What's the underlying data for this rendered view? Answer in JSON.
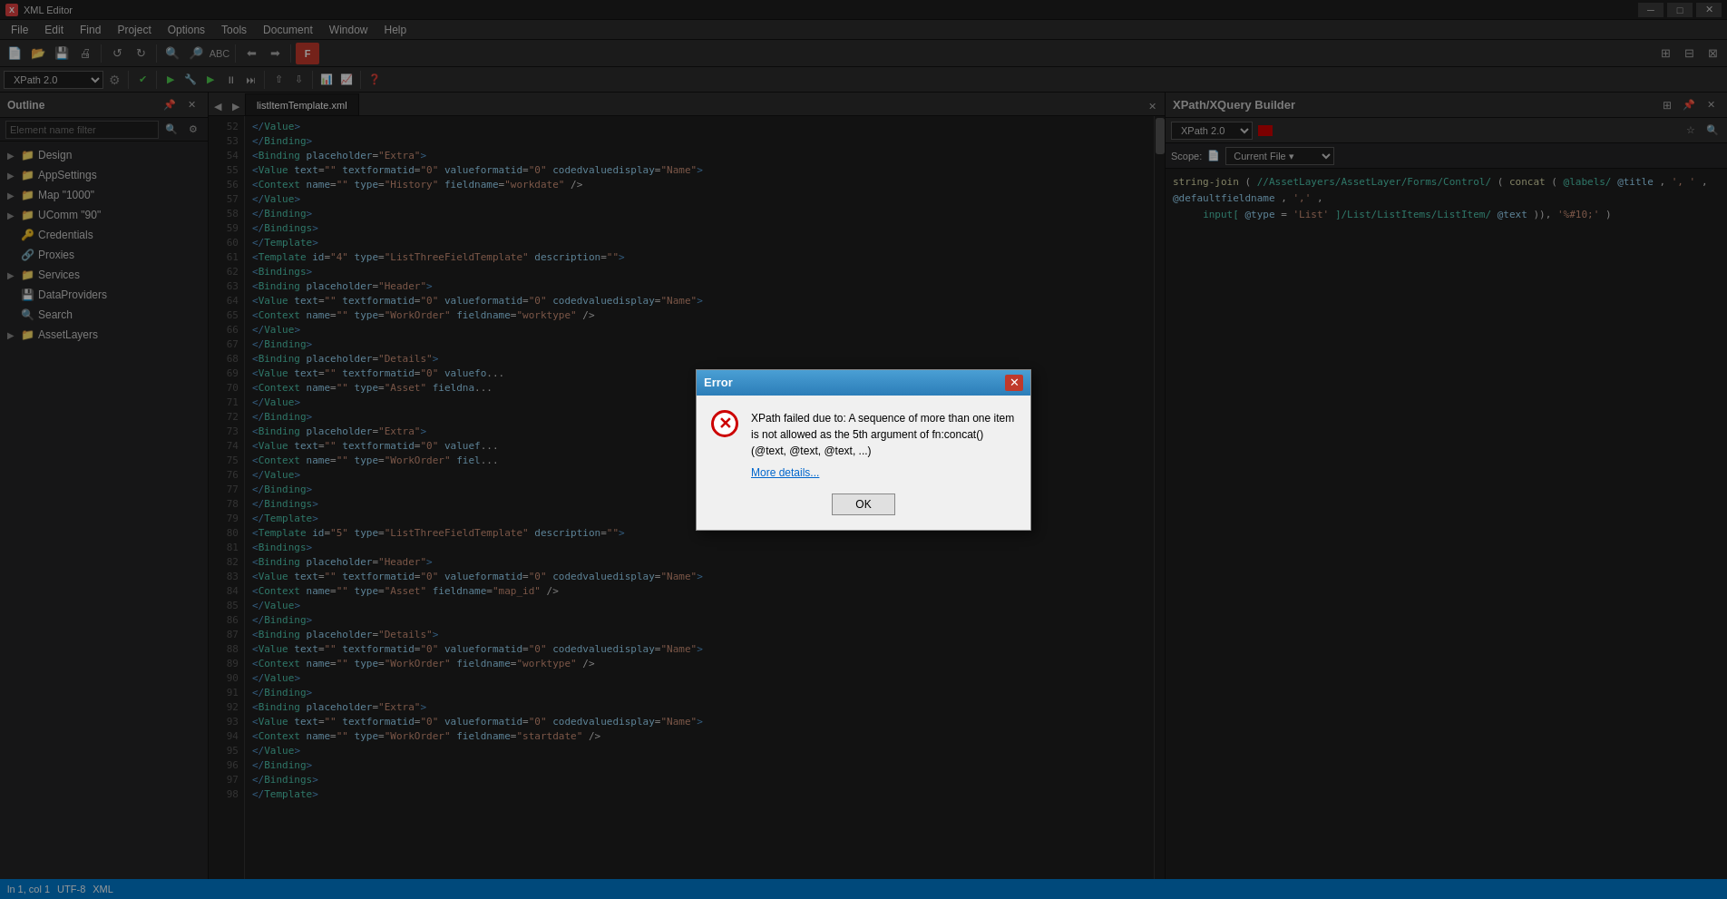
{
  "app": {
    "title": "XML Editor",
    "icon": "X"
  },
  "titlebar": {
    "minimize": "─",
    "maximize": "□",
    "close": "✕"
  },
  "menu": {
    "items": [
      "File",
      "Edit",
      "Find",
      "Project",
      "Options",
      "Tools",
      "Document",
      "Window",
      "Help"
    ]
  },
  "toolbar": {
    "buttons": [
      "📄",
      "📂",
      "💾",
      "🖨",
      "↺",
      "↻",
      "🔍",
      "🔎",
      "📋",
      "⬅",
      "➡",
      "🔴"
    ],
    "xpath_label": "XPath 2.0",
    "play_btn": "▶",
    "tools": [
      "⚙",
      "✔",
      "▶",
      "🔧",
      "▶",
      "⏸",
      "⏭",
      "⏯",
      "🔀",
      "⤶",
      "⤷",
      "📊",
      "📈",
      "❓"
    ]
  },
  "sidebar": {
    "title": "Outline",
    "search_placeholder": "Element name filter",
    "tree_items": [
      {
        "label": "Design",
        "level": 1,
        "has_children": true,
        "expanded": false
      },
      {
        "label": "AppSettings",
        "level": 1,
        "has_children": true,
        "expanded": false
      },
      {
        "label": "Map \"1000\"",
        "level": 1,
        "has_children": true,
        "expanded": false
      },
      {
        "label": "UComm \"90\"",
        "level": 1,
        "has_children": true,
        "expanded": false
      },
      {
        "label": "Credentials",
        "level": 1,
        "has_children": false,
        "expanded": false
      },
      {
        "label": "Proxies",
        "level": 1,
        "has_children": false,
        "expanded": false
      },
      {
        "label": "Services",
        "level": 1,
        "has_children": true,
        "expanded": false
      },
      {
        "label": "DataProviders",
        "level": 1,
        "has_children": false,
        "expanded": false
      },
      {
        "label": "Search",
        "level": 1,
        "has_children": false,
        "expanded": false
      },
      {
        "label": "AssetLayers",
        "level": 1,
        "has_children": true,
        "expanded": false
      }
    ]
  },
  "editor": {
    "title": "listItemTemplate.xml",
    "lines": [
      {
        "num": 52,
        "code": "    </Value>"
      },
      {
        "num": 53,
        "code": "  </Binding>"
      },
      {
        "num": 54,
        "code": "<Binding placeholder=\"Extra\">"
      },
      {
        "num": 55,
        "code": "  <Value text=\"\" textformatid=\"0\" valueformatid=\"0\" codedvaluedisplay=\"Name\">"
      },
      {
        "num": 56,
        "code": "    <Context name=\"\" type=\"History\" fieldname=\"workdate\" />"
      },
      {
        "num": 57,
        "code": "  </Value>"
      },
      {
        "num": 58,
        "code": "</Binding>"
      },
      {
        "num": 59,
        "code": "</Bindings>"
      },
      {
        "num": 60,
        "code": "</Template>"
      },
      {
        "num": 61,
        "code": "<Template id=\"4\" type=\"ListThreeFieldTemplate\" description=\"\">"
      },
      {
        "num": 62,
        "code": "  <Bindings>"
      },
      {
        "num": 63,
        "code": "    <Binding placeholder=\"Header\">"
      },
      {
        "num": 64,
        "code": "      <Value text=\"\" textformatid=\"0\" valueformatid=\"0\" codedvaluedisplay=\"Name\">"
      },
      {
        "num": 65,
        "code": "        <Context name=\"\" type=\"WorkOrder\" fieldname=\"worktype\" />"
      },
      {
        "num": 66,
        "code": "      </Value>"
      },
      {
        "num": 67,
        "code": "    </Binding>"
      },
      {
        "num": 68,
        "code": "    <Binding placeholder=\"Details\">"
      },
      {
        "num": 69,
        "code": "      <Value text=\"\" textformatid=\"0\" valuef..."
      },
      {
        "num": 70,
        "code": "        <Context name=\"\" type=\"Asset\" fieldna..."
      },
      {
        "num": 71,
        "code": "      </Value>"
      },
      {
        "num": 72,
        "code": "    </Binding>"
      },
      {
        "num": 73,
        "code": "    <Binding placeholder=\"Extra\">"
      },
      {
        "num": 74,
        "code": "      <Value text=\"\" textformatid=\"0\" valuef..."
      },
      {
        "num": 75,
        "code": "        <Context name=\"\" type=\"WorkOrder\" fiel..."
      },
      {
        "num": 76,
        "code": "      </Value>"
      },
      {
        "num": 77,
        "code": "    </Binding>"
      },
      {
        "num": 78,
        "code": "  </Bindings>"
      },
      {
        "num": 79,
        "code": "</Template>"
      },
      {
        "num": 80,
        "code": "<Template id=\"5\" type=\"ListThreeFieldTemplate\" description=\"\">"
      },
      {
        "num": 81,
        "code": "  <Bindings>"
      },
      {
        "num": 82,
        "code": "    <Binding placeholder=\"Header\">"
      },
      {
        "num": 83,
        "code": "      <Value text=\"\" textformatid=\"0\" valueformatid=\"0\" codedvaluedisplay=\"Name\">"
      },
      {
        "num": 84,
        "code": "        <Context name=\"\" type=\"Asset\" fieldname=\"map_id\" />"
      },
      {
        "num": 85,
        "code": "      </Value>"
      },
      {
        "num": 86,
        "code": "    </Binding>"
      },
      {
        "num": 87,
        "code": "    <Binding placeholder=\"Details\">"
      },
      {
        "num": 88,
        "code": "      <Value text=\"\" textformatid=\"0\" valueformatid=\"0\" codedvaluedisplay=\"Name\">"
      },
      {
        "num": 89,
        "code": "        <Context name=\"\" type=\"WorkOrder\" fieldname=\"worktype\" />"
      },
      {
        "num": 90,
        "code": "      </Value>"
      },
      {
        "num": 91,
        "code": "    </Binding>"
      },
      {
        "num": 92,
        "code": "    <Binding placeholder=\"Extra\">"
      },
      {
        "num": 93,
        "code": "      <Value text=\"\" textformatid=\"0\" valueformatid=\"0\" codedvaluedisplay=\"Name\">"
      },
      {
        "num": 94,
        "code": "        <Context name=\"\" type=\"WorkOrder\" fieldname=\"startdate\" />"
      },
      {
        "num": 95,
        "code": "      </Value>"
      },
      {
        "num": 96,
        "code": "    </Binding>"
      },
      {
        "num": 97,
        "code": "  </Bindings>"
      },
      {
        "num": 98,
        "code": "</Template>"
      }
    ]
  },
  "xpath_builder": {
    "title": "XPath/XQuery Builder",
    "version": "XPath 2.0",
    "scope_label": "Scope:",
    "scope_file_icon": "📄",
    "scope_value": "Current File",
    "expression": "string-join(//AssetLayers/AssetLayer/Forms/Control/(concat(@labels/@title,', ', @defaultfieldname,', ', input[@type='List']/List/ListItems/ListItem/@text)), '%#10;')"
  },
  "dialog": {
    "title": "Error",
    "message": "XPath failed due to: A sequence of more than one item is not allowed as the 5th argument of fn:concat() (@text, @text, @text, ...)",
    "details_link": "More details...",
    "ok_button": "OK",
    "error_symbol": "✕"
  },
  "status_bar": {
    "info": ""
  }
}
